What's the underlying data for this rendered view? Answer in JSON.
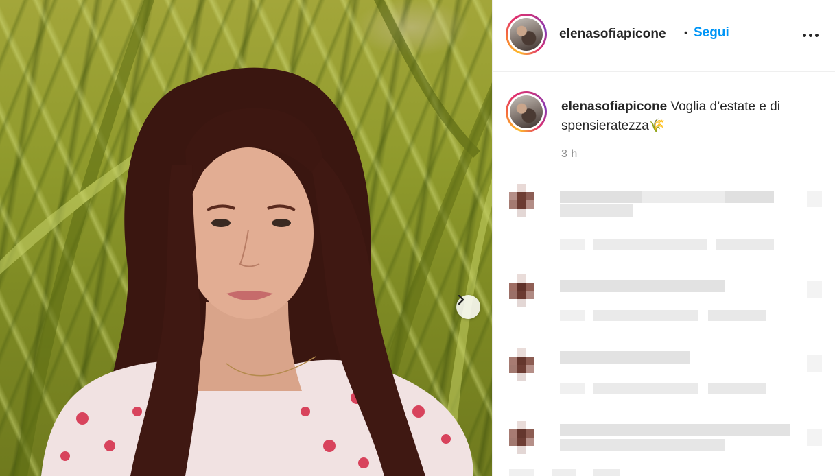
{
  "post": {
    "username": "elenasofiapicone",
    "follow_label": "Segui",
    "separator": "•",
    "caption_username": "elenasofiapicone",
    "caption_text": " Voglia d’estate e di spensieratezza🌾",
    "time_ago": "3 h"
  },
  "icons": {
    "more_options": "more-horizontal-icon",
    "next": "chevron-right-icon"
  },
  "colors": {
    "follow_blue": "#0095f6",
    "text": "#262626",
    "muted": "#8e8e8e",
    "divider": "#efefef"
  },
  "comments": [
    {
      "blurred": true
    },
    {
      "blurred": true
    },
    {
      "blurred": true
    },
    {
      "blurred": true
    }
  ]
}
